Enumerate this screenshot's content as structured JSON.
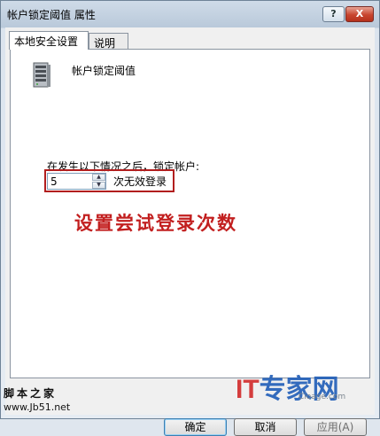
{
  "window": {
    "title": "帐户锁定阈值 属性"
  },
  "titlebar": {
    "help": "?",
    "close": "X"
  },
  "tabs": [
    {
      "label": "本地安全设置",
      "active": true
    },
    {
      "label": "说明",
      "active": false
    }
  ],
  "policy": {
    "icon": "server-icon",
    "title": "帐户锁定阈值",
    "lockout_label": "在发生以下情况之后，锁定帐户:",
    "value": "5",
    "unit": "次无效登录"
  },
  "annotation": "设置尝试登录次数",
  "buttons": {
    "ok": "确定",
    "cancel": "取消",
    "apply": "应用(A)"
  },
  "watermarks": {
    "it_brand_red": "IT",
    "it_brand_blue": "专家网",
    "it_sub": "Cioage.com",
    "site_name": "脚本之家",
    "site_url": "www.Jb51.net"
  },
  "colors": {
    "highlight": "#b21e1e",
    "annotation": "#c21f1f"
  }
}
